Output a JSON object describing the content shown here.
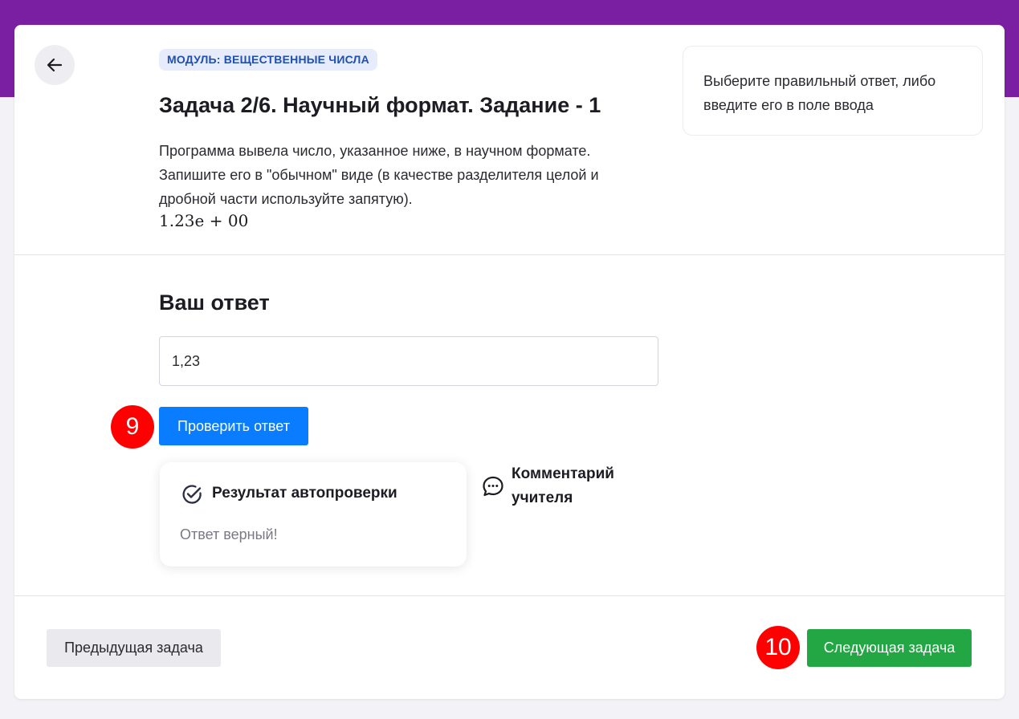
{
  "task": {
    "module_badge": "МОДУЛЬ: ВЕЩЕСТВЕННЫЕ ЧИСЛА",
    "title": "Задача 2/6. Научный формат. Задание - 1",
    "description": "Программа вывела число, указанное ниже, в научном формате. Запишите его в \"обычном\" виде (в качестве разделителя целой и дробной части используйте запятую).",
    "formula": "1.23e + 00"
  },
  "hint": {
    "text": "Выберите правильный ответ, либо введите его в поле ввода"
  },
  "answer": {
    "heading": "Ваш ответ",
    "input_value": "1,23",
    "check_button": "Проверить ответ"
  },
  "result": {
    "title": "Результат автопроверки",
    "message": "Ответ верный!"
  },
  "comment": {
    "label": "Комментарий учителя"
  },
  "navigation": {
    "prev_button": "Предыдущая задача",
    "next_button": "Следующая задача"
  },
  "step_markers": {
    "check": "9",
    "next": "10"
  },
  "colors": {
    "header_band": "#7b1fa2",
    "check_button": "#0a7cff",
    "next_button": "#23a744",
    "step_marker": "#ff0000",
    "badge_text": "#1f4fb3"
  },
  "icons": {
    "back": "arrow-left-icon",
    "result": "check-circle-icon",
    "comment": "chat-bubble-icon"
  }
}
